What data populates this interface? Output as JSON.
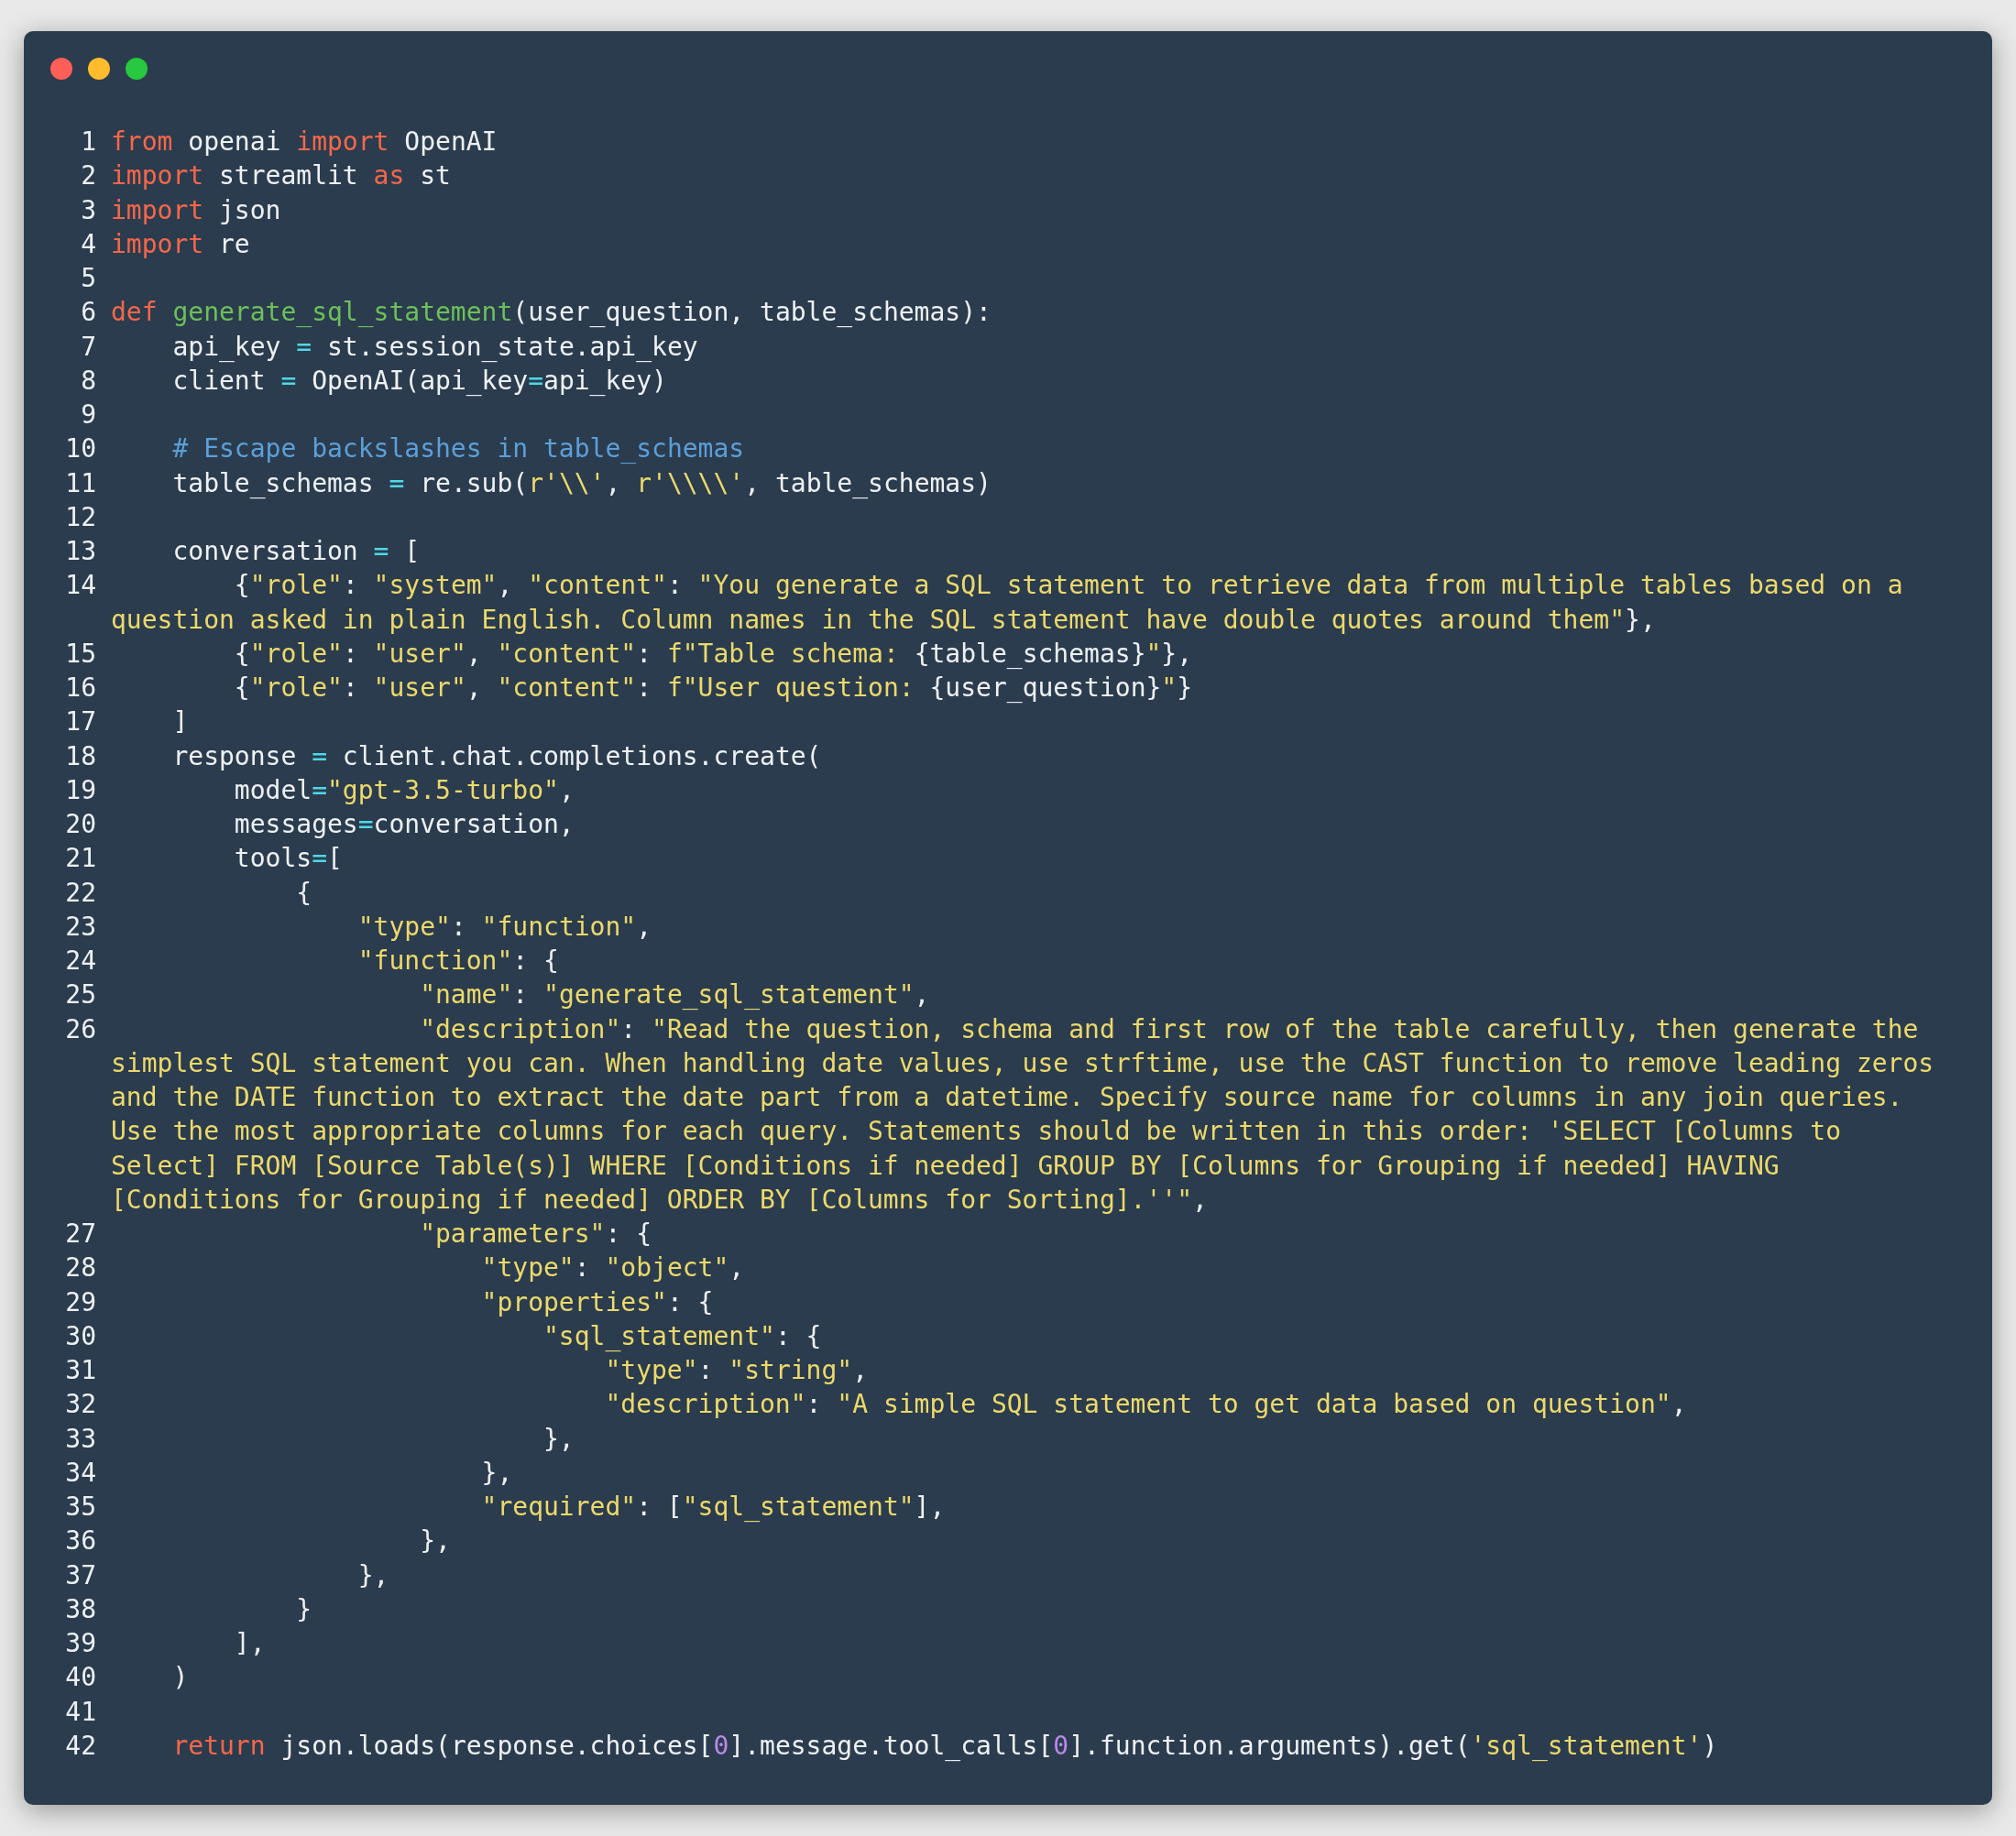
{
  "lines": [
    {
      "number": "1",
      "tokens": [
        {
          "kind": "keyword",
          "text": "from"
        },
        {
          "kind": "plain",
          "text": " openai "
        },
        {
          "kind": "keyword",
          "text": "import"
        },
        {
          "kind": "plain",
          "text": " OpenAI"
        }
      ]
    },
    {
      "number": "2",
      "tokens": [
        {
          "kind": "keyword",
          "text": "import"
        },
        {
          "kind": "plain",
          "text": " streamlit "
        },
        {
          "kind": "keyword",
          "text": "as"
        },
        {
          "kind": "plain",
          "text": " st"
        }
      ]
    },
    {
      "number": "3",
      "tokens": [
        {
          "kind": "keyword",
          "text": "import"
        },
        {
          "kind": "plain",
          "text": " json"
        }
      ]
    },
    {
      "number": "4",
      "tokens": [
        {
          "kind": "keyword",
          "text": "import"
        },
        {
          "kind": "plain",
          "text": " re"
        }
      ]
    },
    {
      "number": "5"
    },
    {
      "number": "6",
      "tokens": [
        {
          "kind": "keyword",
          "text": "def"
        },
        {
          "kind": "function",
          "text": " generate_sql_statement"
        },
        {
          "kind": "plain",
          "text": "(user_question, table_schemas):"
        }
      ]
    },
    {
      "number": "7",
      "tokens": [
        {
          "kind": "plain",
          "text": "    api_key "
        },
        {
          "kind": "operator",
          "text": "="
        },
        {
          "kind": "plain",
          "text": " st.session_state.api_key"
        }
      ]
    },
    {
      "number": "8",
      "tokens": [
        {
          "kind": "plain",
          "text": "    client "
        },
        {
          "kind": "operator",
          "text": "="
        },
        {
          "kind": "plain",
          "text": " OpenAI(api_key"
        },
        {
          "kind": "operator",
          "text": "="
        },
        {
          "kind": "plain",
          "text": "api_key)"
        }
      ]
    },
    {
      "number": "9"
    },
    {
      "number": "10",
      "tokens": [
        {
          "kind": "comment",
          "text": "    # Escape backslashes in table_schemas"
        }
      ]
    },
    {
      "number": "11",
      "tokens": [
        {
          "kind": "plain",
          "text": "    table_schemas "
        },
        {
          "kind": "operator",
          "text": "="
        },
        {
          "kind": "plain",
          "text": " re.sub("
        },
        {
          "kind": "string",
          "text": "r'\\\\'"
        },
        {
          "kind": "plain",
          "text": ", "
        },
        {
          "kind": "string",
          "text": "r'\\\\\\\\'"
        },
        {
          "kind": "plain",
          "text": ", table_schemas)"
        }
      ]
    },
    {
      "number": "12"
    },
    {
      "number": "13",
      "tokens": [
        {
          "kind": "plain",
          "text": "    conversation "
        },
        {
          "kind": "operator",
          "text": "="
        },
        {
          "kind": "plain",
          "text": " ["
        }
      ]
    },
    {
      "number": "14",
      "tokens": [
        {
          "kind": "plain",
          "text": "        {"
        },
        {
          "kind": "string",
          "text": "\"role\""
        },
        {
          "kind": "plain",
          "text": ": "
        },
        {
          "kind": "string",
          "text": "\"system\""
        },
        {
          "kind": "plain",
          "text": ", "
        },
        {
          "kind": "string",
          "text": "\"content\""
        },
        {
          "kind": "plain",
          "text": ": "
        },
        {
          "kind": "string",
          "text": "\"You generate a SQL statement to retrieve data from multiple tables based on a question asked in plain English. Column names in the SQL statement have double quotes around them\""
        },
        {
          "kind": "plain",
          "text": "},"
        }
      ]
    },
    {
      "number": "15",
      "tokens": [
        {
          "kind": "plain",
          "text": "        {"
        },
        {
          "kind": "string",
          "text": "\"role\""
        },
        {
          "kind": "plain",
          "text": ": "
        },
        {
          "kind": "string",
          "text": "\"user\""
        },
        {
          "kind": "plain",
          "text": ", "
        },
        {
          "kind": "string",
          "text": "\"content\""
        },
        {
          "kind": "plain",
          "text": ": "
        },
        {
          "kind": "string",
          "text": "f\"Table schema: "
        },
        {
          "kind": "plain",
          "text": "{table_schemas}"
        },
        {
          "kind": "string",
          "text": "\""
        },
        {
          "kind": "plain",
          "text": "},"
        }
      ]
    },
    {
      "number": "16",
      "tokens": [
        {
          "kind": "plain",
          "text": "        {"
        },
        {
          "kind": "string",
          "text": "\"role\""
        },
        {
          "kind": "plain",
          "text": ": "
        },
        {
          "kind": "string",
          "text": "\"user\""
        },
        {
          "kind": "plain",
          "text": ", "
        },
        {
          "kind": "string",
          "text": "\"content\""
        },
        {
          "kind": "plain",
          "text": ": "
        },
        {
          "kind": "string",
          "text": "f\"User question: "
        },
        {
          "kind": "plain",
          "text": "{user_question}"
        },
        {
          "kind": "string",
          "text": "\""
        },
        {
          "kind": "plain",
          "text": "}"
        }
      ]
    },
    {
      "number": "17",
      "tokens": [
        {
          "kind": "plain",
          "text": "    ]"
        }
      ]
    },
    {
      "number": "18",
      "tokens": [
        {
          "kind": "plain",
          "text": "    response "
        },
        {
          "kind": "operator",
          "text": "="
        },
        {
          "kind": "plain",
          "text": " client.chat.completions.create("
        }
      ]
    },
    {
      "number": "19",
      "tokens": [
        {
          "kind": "plain",
          "text": "        model"
        },
        {
          "kind": "operator",
          "text": "="
        },
        {
          "kind": "string",
          "text": "\"gpt-3.5-turbo\""
        },
        {
          "kind": "plain",
          "text": ","
        }
      ]
    },
    {
      "number": "20",
      "tokens": [
        {
          "kind": "plain",
          "text": "        messages"
        },
        {
          "kind": "operator",
          "text": "="
        },
        {
          "kind": "plain",
          "text": "conversation,"
        }
      ]
    },
    {
      "number": "21",
      "tokens": [
        {
          "kind": "plain",
          "text": "        tools"
        },
        {
          "kind": "operator",
          "text": "="
        },
        {
          "kind": "plain",
          "text": "["
        }
      ]
    },
    {
      "number": "22",
      "tokens": [
        {
          "kind": "plain",
          "text": "            {"
        }
      ]
    },
    {
      "number": "23",
      "tokens": [
        {
          "kind": "string",
          "text": "                \"type\""
        },
        {
          "kind": "plain",
          "text": ": "
        },
        {
          "kind": "string",
          "text": "\"function\""
        },
        {
          "kind": "plain",
          "text": ","
        }
      ]
    },
    {
      "number": "24",
      "tokens": [
        {
          "kind": "string",
          "text": "                \"function\""
        },
        {
          "kind": "plain",
          "text": ": {"
        }
      ]
    },
    {
      "number": "25",
      "tokens": [
        {
          "kind": "string",
          "text": "                    \"name\""
        },
        {
          "kind": "plain",
          "text": ": "
        },
        {
          "kind": "string",
          "text": "\"generate_sql_statement\""
        },
        {
          "kind": "plain",
          "text": ","
        }
      ]
    },
    {
      "number": "26",
      "tokens": [
        {
          "kind": "string",
          "text": "                    \"description\""
        },
        {
          "kind": "plain",
          "text": ": "
        },
        {
          "kind": "string",
          "text": "\"Read the question, schema and first row of the table carefully, then generate the simplest SQL statement you can. When handling date values, use strftime, use the CAST function to remove leading zeros and the DATE function to extract the date part from a datetime. Specify source name for columns in any join queries. Use the most appropriate columns for each query. Statements should be written in this order: 'SELECT [Columns to Select] FROM [Source Table(s)] WHERE [Conditions if needed] GROUP BY [Columns for Grouping if needed] HAVING [Conditions for Grouping if needed] ORDER BY [Columns for Sorting].''\""
        },
        {
          "kind": "plain",
          "text": ","
        }
      ]
    },
    {
      "number": "27",
      "tokens": [
        {
          "kind": "string",
          "text": "                    \"parameters\""
        },
        {
          "kind": "plain",
          "text": ": {"
        }
      ]
    },
    {
      "number": "28",
      "tokens": [
        {
          "kind": "string",
          "text": "                        \"type\""
        },
        {
          "kind": "plain",
          "text": ": "
        },
        {
          "kind": "string",
          "text": "\"object\""
        },
        {
          "kind": "plain",
          "text": ","
        }
      ]
    },
    {
      "number": "29",
      "tokens": [
        {
          "kind": "string",
          "text": "                        \"properties\""
        },
        {
          "kind": "plain",
          "text": ": {"
        }
      ]
    },
    {
      "number": "30",
      "tokens": [
        {
          "kind": "string",
          "text": "                            \"sql_statement\""
        },
        {
          "kind": "plain",
          "text": ": {"
        }
      ]
    },
    {
      "number": "31",
      "tokens": [
        {
          "kind": "string",
          "text": "                                \"type\""
        },
        {
          "kind": "plain",
          "text": ": "
        },
        {
          "kind": "string",
          "text": "\"string\""
        },
        {
          "kind": "plain",
          "text": ","
        }
      ]
    },
    {
      "number": "32",
      "tokens": [
        {
          "kind": "string",
          "text": "                                \"description\""
        },
        {
          "kind": "plain",
          "text": ": "
        },
        {
          "kind": "string",
          "text": "\"A simple SQL statement to get data based on question\""
        },
        {
          "kind": "plain",
          "text": ","
        }
      ]
    },
    {
      "number": "33",
      "tokens": [
        {
          "kind": "plain",
          "text": "                            },"
        }
      ]
    },
    {
      "number": "34",
      "tokens": [
        {
          "kind": "plain",
          "text": "                        },"
        }
      ]
    },
    {
      "number": "35",
      "tokens": [
        {
          "kind": "string",
          "text": "                        \"required\""
        },
        {
          "kind": "plain",
          "text": ": ["
        },
        {
          "kind": "string",
          "text": "\"sql_statement\""
        },
        {
          "kind": "plain",
          "text": "],"
        }
      ]
    },
    {
      "number": "36",
      "tokens": [
        {
          "kind": "plain",
          "text": "                    },"
        }
      ]
    },
    {
      "number": "37",
      "tokens": [
        {
          "kind": "plain",
          "text": "                },"
        }
      ]
    },
    {
      "number": "38",
      "tokens": [
        {
          "kind": "plain",
          "text": "            }"
        }
      ]
    },
    {
      "number": "39",
      "tokens": [
        {
          "kind": "plain",
          "text": "        ],"
        }
      ]
    },
    {
      "number": "40",
      "tokens": [
        {
          "kind": "plain",
          "text": "    )"
        }
      ]
    },
    {
      "number": "41"
    },
    {
      "number": "42",
      "tokens": [
        {
          "kind": "keyword",
          "text": "    return"
        },
        {
          "kind": "plain",
          "text": " json.loads(response.choices["
        },
        {
          "kind": "number",
          "text": "0"
        },
        {
          "kind": "plain",
          "text": "].message.tool_calls["
        },
        {
          "kind": "number",
          "text": "0"
        },
        {
          "kind": "plain",
          "text": "].function.arguments).get("
        },
        {
          "kind": "string",
          "text": "'sql_statement'"
        },
        {
          "kind": "plain",
          "text": ")"
        }
      ]
    }
  ]
}
